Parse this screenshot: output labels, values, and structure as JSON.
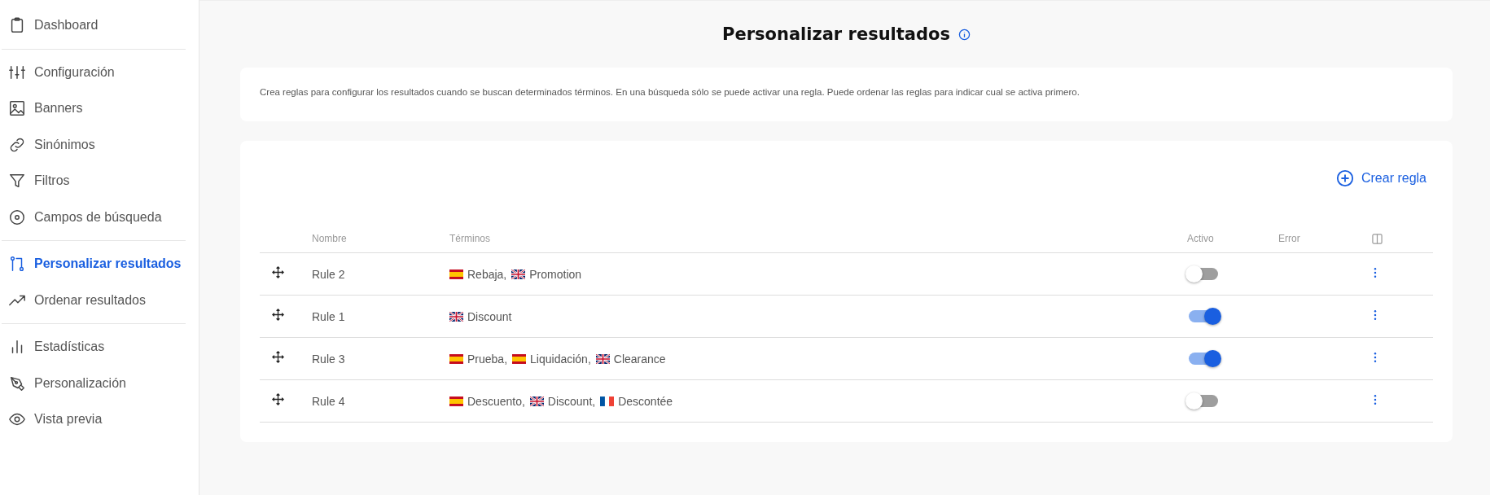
{
  "sidebar": {
    "sections": [
      {
        "items": [
          {
            "label": "Dashboard",
            "selected": false
          }
        ]
      },
      {
        "items": [
          {
            "label": "Configuración",
            "selected": false
          },
          {
            "label": "Banners",
            "selected": false
          },
          {
            "label": "Sinónimos",
            "selected": false
          },
          {
            "label": "Filtros",
            "selected": false
          },
          {
            "label": "Campos de búsqueda",
            "selected": false
          }
        ]
      },
      {
        "items": [
          {
            "label": "Personalizar resultados",
            "selected": true
          },
          {
            "label": "Ordenar resultados",
            "selected": false
          }
        ]
      },
      {
        "items": [
          {
            "label": "Estadísticas",
            "selected": false
          },
          {
            "label": "Personalización",
            "selected": false
          },
          {
            "label": "Vista previa",
            "selected": false
          }
        ]
      }
    ]
  },
  "page": {
    "title": "Personalizar resultados",
    "description": "Crea reglas para configurar los resultados cuando se buscan determinados términos. En una búsqueda sólo se puede activar una regla. Puede ordenar las reglas para indicar cual se activa primero."
  },
  "create_button": "Crear regla",
  "table": {
    "columns": [
      "Nombre",
      "Términos",
      "Activo",
      "Error"
    ],
    "rows": [
      {
        "name": "Rule 2",
        "terms": [
          {
            "kind": "spanish",
            "text": "Rebaja,"
          },
          {
            "kind": "english",
            "text": "Promotion"
          }
        ],
        "active": false
      },
      {
        "name": "Rule 1",
        "terms": [
          {
            "kind": "english",
            "text": "Discount"
          }
        ],
        "active": true
      },
      {
        "name": "Rule 3",
        "terms": [
          {
            "kind": "spanish",
            "text": "Prueba,"
          },
          {
            "kind": "spanish",
            "text": "Liquidación,"
          },
          {
            "kind": "english",
            "text": "Clearance"
          }
        ],
        "active": true
      },
      {
        "name": "Rule 4",
        "terms": [
          {
            "kind": "spanish",
            "text": "Descuento,"
          },
          {
            "kind": "english",
            "text": "Discount,"
          },
          {
            "kind": "french",
            "text": "Descontée"
          }
        ],
        "active": false
      }
    ]
  }
}
